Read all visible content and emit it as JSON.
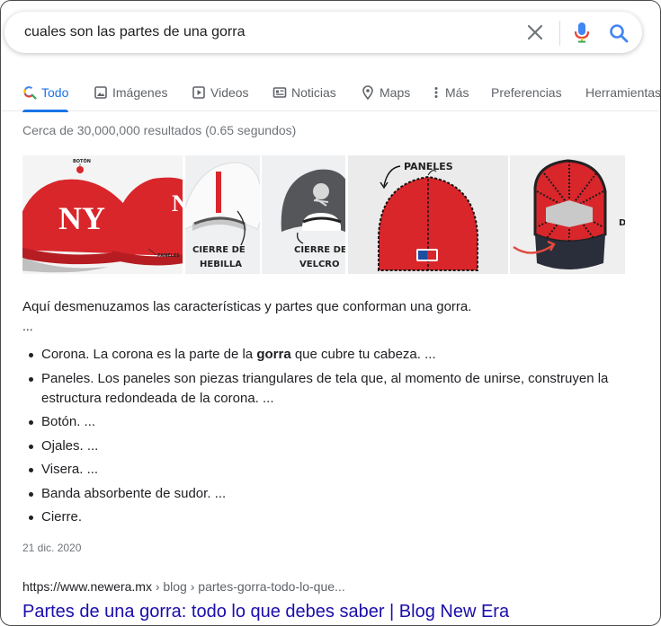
{
  "search": {
    "query": "cuales son las partes de una gorra"
  },
  "tabs": [
    {
      "label": "Todo",
      "icon": "search-icon",
      "active": true
    },
    {
      "label": "Imágenes",
      "icon": "image-icon"
    },
    {
      "label": "Videos",
      "icon": "play-icon"
    },
    {
      "label": "Noticias",
      "icon": "news-icon"
    },
    {
      "label": "Maps",
      "icon": "map-pin-icon"
    },
    {
      "label": "Más",
      "icon": "more-vertical-icon"
    },
    {
      "label": "Preferencias"
    },
    {
      "label": "Herramientas"
    }
  ],
  "result_stats": "Cerca de 30,000,000 resultados (0.65 segundos)",
  "images": {
    "labels": {
      "boton": "BOTÓN",
      "paneles_small": "PANELES",
      "cierre_hebilla_1": "CIERRE DE",
      "cierre_hebilla_2": "HEBILLA",
      "cierre_velcro_1": "CIERRE DE",
      "cierre_velcro_2": "VELCRO",
      "paneles": "PANELES",
      "cut_letter": "D"
    }
  },
  "snippet": {
    "intro": "Aquí desmenuzamos las características y partes que conforman una gorra.",
    "ellipsis": "...",
    "items": [
      {
        "pre": "Corona. La corona es la parte de la ",
        "bold": "gorra",
        "post": " que cubre tu cabeza. ..."
      },
      {
        "pre": "Paneles. Los paneles son piezas triangulares de tela que, al momento de unirse, construyen la estructura redondeada de la corona. ...",
        "bold": "",
        "post": ""
      },
      {
        "pre": "Botón. ...",
        "bold": "",
        "post": ""
      },
      {
        "pre": "Ojales. ...",
        "bold": "",
        "post": ""
      },
      {
        "pre": "Visera. ...",
        "bold": "",
        "post": ""
      },
      {
        "pre": "Banda absorbente de sudor. ...",
        "bold": "",
        "post": ""
      },
      {
        "pre": "Cierre.",
        "bold": "",
        "post": ""
      }
    ],
    "date": "21 dic. 2020"
  },
  "source": {
    "domain": "https://www.newera.mx",
    "path": " › blog › partes-gorra-todo-lo-que...",
    "title": "Partes de una gorra: todo lo que debes saber | Blog New Era"
  },
  "colors": {
    "link": "#1a0dab",
    "accent": "#1a73e8",
    "cap_red": "#d9262b"
  }
}
